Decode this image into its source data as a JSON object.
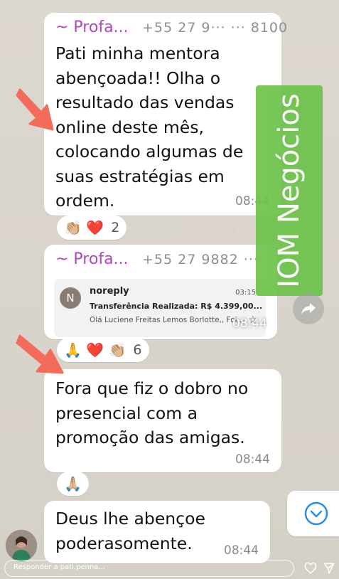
{
  "messages": [
    {
      "sender": "~ Profa...",
      "phone": "+55 27 9··· ··· 8100",
      "lines": [
        "Pati minha mentora",
        "abençoada!! Olha o",
        "resultado das vendas",
        "online deste mês,",
        "colocando algumas de",
        "suas estratégias em",
        "ordem."
      ],
      "time": "08:44",
      "reactions": {
        "emojis": "👏🏼 ❤️",
        "count": "2"
      }
    },
    {
      "sender": "~ Profa...",
      "phone": "+55 27 9882 ···",
      "email": {
        "avatar_letter": "N",
        "from": "noreply",
        "time": "03:15",
        "subject": "Transferência Realizada: R$ 4.399,00...",
        "preview": "Olá Luciene Freitas Lemos Borlotte,, Foi..."
      },
      "time": "08:44",
      "reactions": {
        "emojis": "🙏 ❤️ 👏🏼",
        "count": "6"
      }
    },
    {
      "lines": [
        "Fora que fiz o dobro no",
        "presencial com a",
        "promoção das amigas."
      ],
      "time": "08:44",
      "reactions": {
        "emojis": "🙏🏼"
      }
    },
    {
      "lines": [
        "Deus lhe abençoe",
        "poderasomente."
      ],
      "time": "08:44"
    }
  ],
  "banner": {
    "text": "IOM Negócios",
    "color": "#6cc24a"
  },
  "reply": {
    "placeholder": "Responder a pati.penna..."
  },
  "icons": {
    "heart": "heart-icon",
    "send": "send-icon",
    "scroll_down": "chevron-down-icon",
    "forward": "forward-icon"
  },
  "colors": {
    "sender": "#b146c2",
    "arrow": "#f26b5b",
    "bubble": "#ffffff"
  }
}
